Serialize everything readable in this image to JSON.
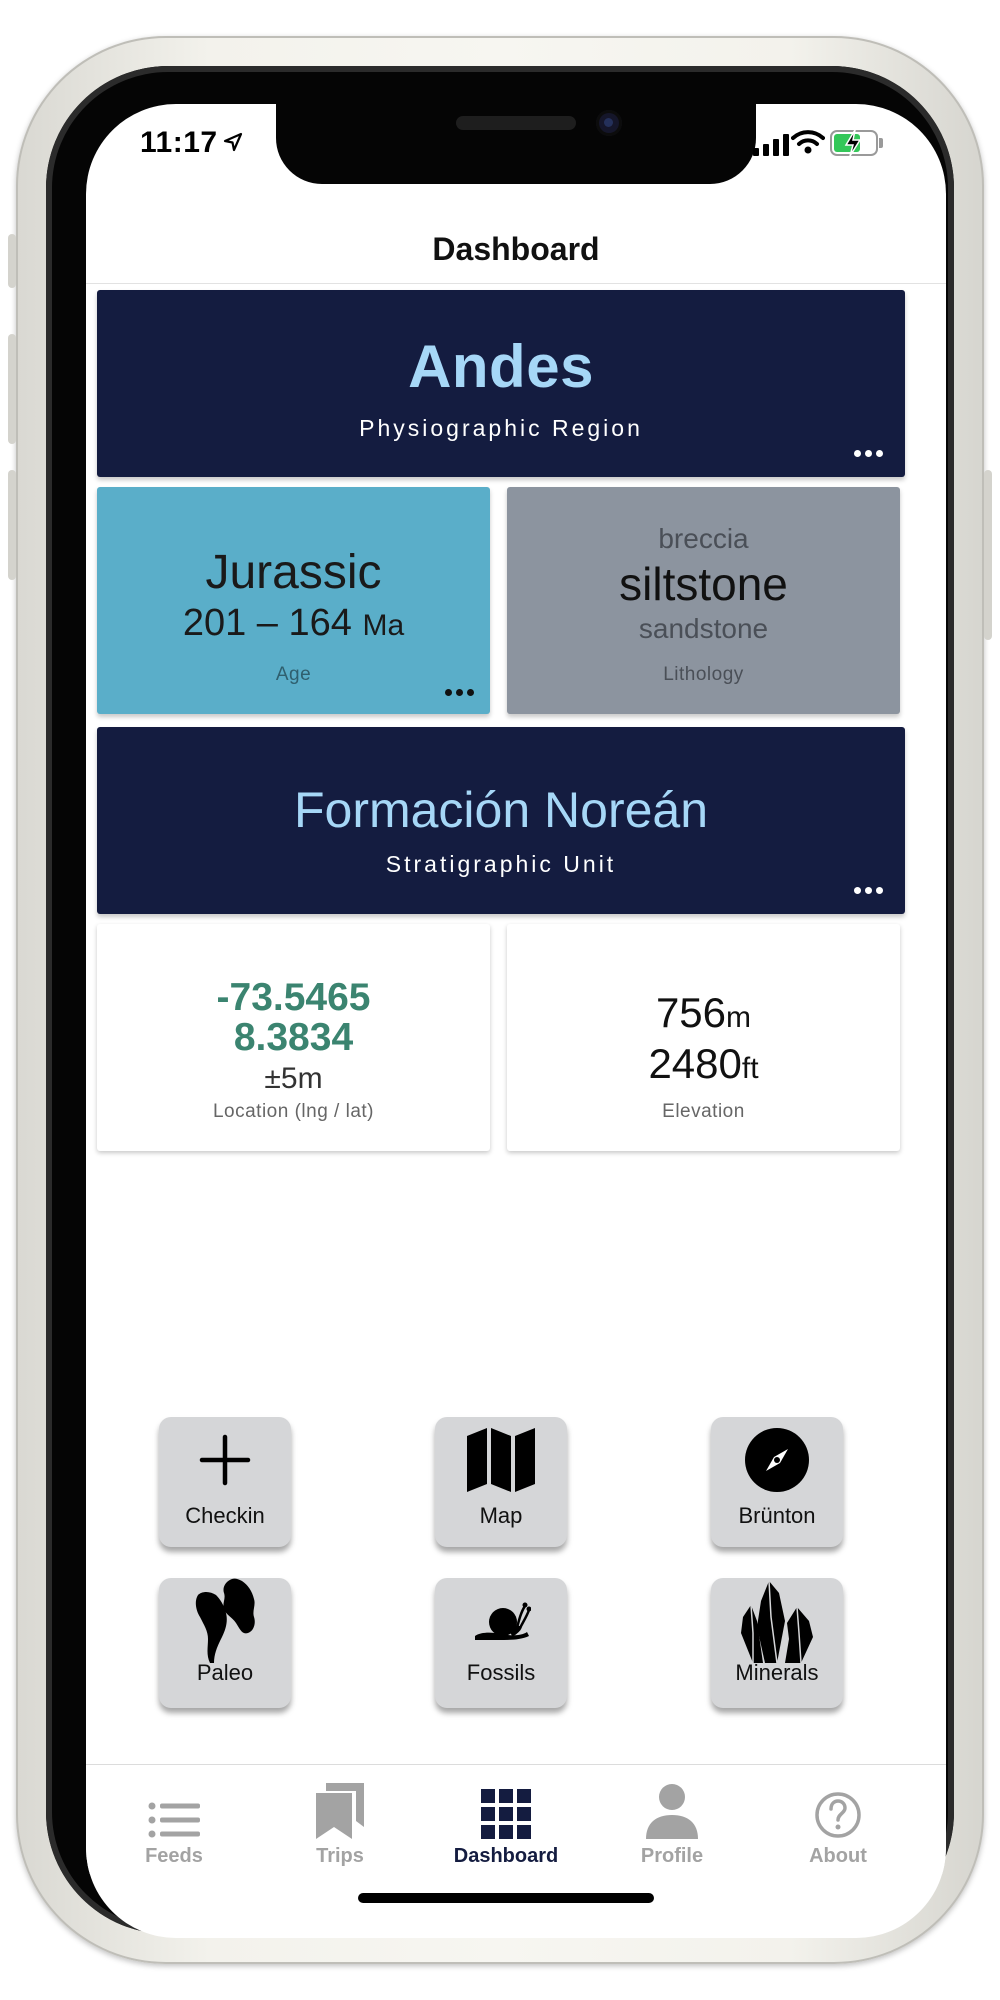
{
  "status_bar": {
    "time": "11:17"
  },
  "header": {
    "title": "Dashboard"
  },
  "region": {
    "name": "Andes",
    "label": "Physiographic Region"
  },
  "age": {
    "era": "Jurassic",
    "range": "201 – 164",
    "unit": "Ma",
    "label": "Age"
  },
  "lithology": {
    "minor_top": "breccia",
    "major": "siltstone",
    "minor_bottom": "sandstone",
    "label": "Lithology"
  },
  "stratigraphy": {
    "name": "Formación Noreán",
    "label": "Stratigraphic Unit"
  },
  "location": {
    "lng": "-73.5465",
    "lat": "8.3834",
    "accuracy": "±5m",
    "label": "Location (lng / lat)"
  },
  "elevation": {
    "meters": "756",
    "meters_unit": "m",
    "feet": "2480",
    "feet_unit": "ft",
    "label": "Elevation"
  },
  "actions": [
    {
      "label": "Checkin",
      "icon": "plus-icon"
    },
    {
      "label": "Map",
      "icon": "map-icon"
    },
    {
      "label": "Brünton",
      "icon": "compass-icon"
    },
    {
      "label": "Paleo",
      "icon": "continents-icon"
    },
    {
      "label": "Fossils",
      "icon": "snail-icon"
    },
    {
      "label": "Minerals",
      "icon": "crystal-icon"
    }
  ],
  "tabs": [
    {
      "label": "Feeds",
      "icon": "list-icon",
      "active": false
    },
    {
      "label": "Trips",
      "icon": "bookmarks-icon",
      "active": false
    },
    {
      "label": "Dashboard",
      "icon": "grid-icon",
      "active": true
    },
    {
      "label": "Profile",
      "icon": "person-icon",
      "active": false
    },
    {
      "label": "About",
      "icon": "question-icon",
      "active": false
    }
  ],
  "colors": {
    "card_dark": "#141c40",
    "card_age": "#5aaec9",
    "card_lithology": "#8c949f",
    "title_light_blue": "#a6d7f7",
    "coordinate_green": "#3b8470",
    "tab_active": "#141c40",
    "tab_inactive": "#a3a3a3",
    "battery_green": "#34c759"
  }
}
